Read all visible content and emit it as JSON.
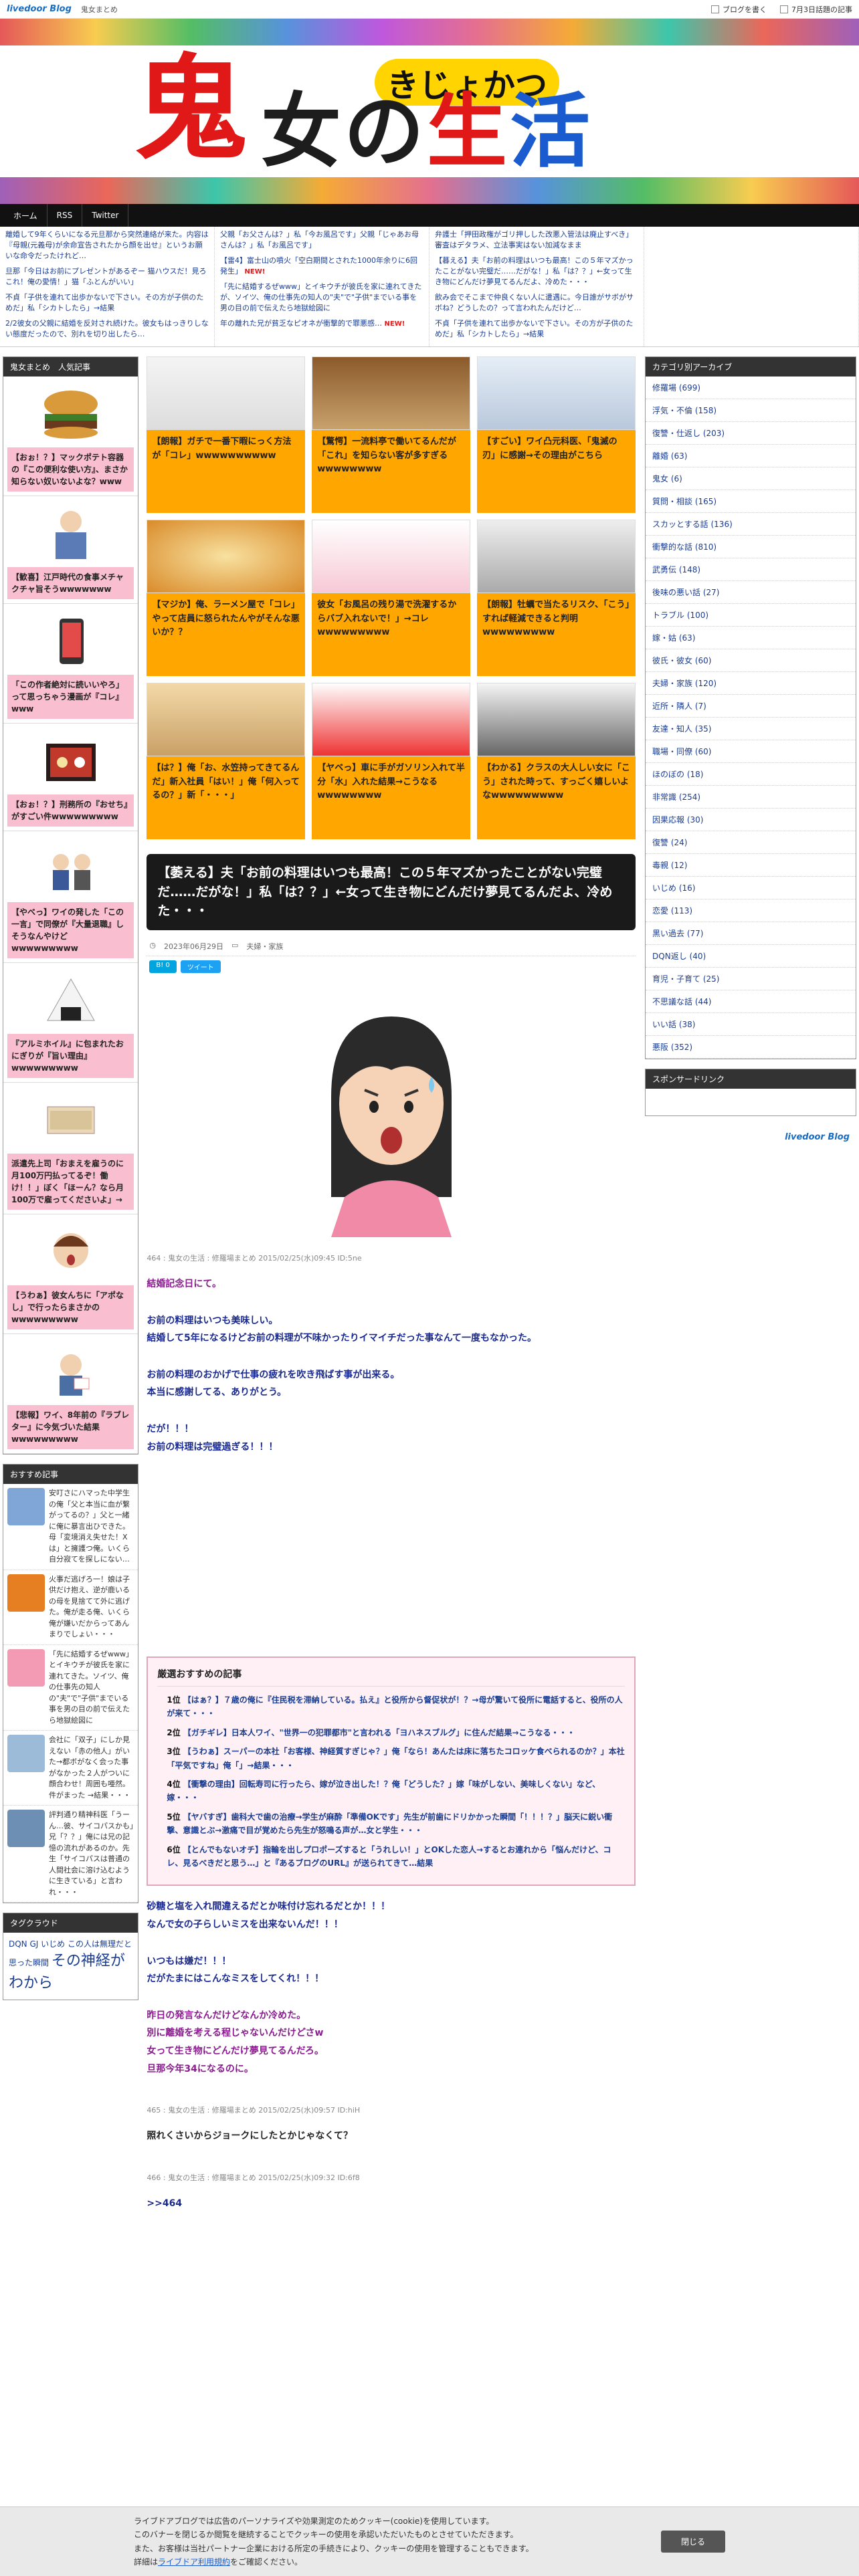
{
  "topbar": {
    "logo": "livedoor Blog",
    "blog_name": "鬼女まとめ",
    "write_link": "ブログを書く",
    "hot_link": "7月3日話題の記事"
  },
  "banner": {
    "kanji_oni": "鬼",
    "kanji_no": "の",
    "kanji_sei": "生",
    "kanji_katsu": "活",
    "kanji_onna": "女",
    "ruby": "きじょかつ"
  },
  "nav": [
    "ホーム",
    "RSS",
    "Twitter"
  ],
  "ticker": [
    [
      "離婚して9年くらいになる元旦那から突然連絡が来た。内容は『母親(元義母)が余命宣告されたから顔を出せ』というお願いな命令だったけれど…",
      "旦那「今日はお前にプレゼントがあるぞー 猫ハウスだ！見ろこれ！俺の愛情！」猫「ふとんがいい」",
      "不貞「子供を連れて出歩かないで下さい。その方が子供のためだ」私「シカトしたら」→結果",
      "2/2彼女の父親に結婚を反対され続けた。彼女もはっきりしない態度だったので、別れを切り出したら…"
    ],
    [
      "父親「お父さんは？」私「今お風呂です」父親「じゃあお母さんは？」私「お風呂です」",
      "【雷4】富士山の噴火「空白期間とされた1000年余りに6回発生」",
      "「先に結婚するぜwww」とイキウチが彼氏を家に連れてきたが、ソイツ、俺の仕事先の知人の\"夫\"で\"子供\"までいる事を男の目の前で伝えたら地獄絵図に",
      "年の離れた兄が貧乏なピオネが衝撃的で罪悪感…"
    ],
    [
      "弁護士「押田政権がゴリ押しした改悪入管法は廃止すべき」審査はデタラメ、立法事実はない加減なまま",
      "【暮える】夫「お前の料理はいつも最高！この５年マズかったことがない完璧だ……だがな！」私「は？？」←女って生き物にどんだけ夢見てるんだよ、冷めた・・・",
      "飲み会でそこまで仲良くない人に遭遇に。今日誰がサボがサボね？どうしたの？って言われたんだけど…",
      "不貞「子供を連れて出歩かないで下さい。その方が子供のためだ」私「シカトしたら」→結果"
    ],
    []
  ],
  "left": {
    "popular_title": "鬼女まとめ　人気記事",
    "popular": [
      "【おぉ！？】マックポテト容器の『この便利な使い方』、まさか知らない奴いないよな？www",
      "【歓喜】江戸時代の食事メチャクチャ旨そうwwwwwww",
      "「この作者絶対に読いいやろ」って思っちゃう漫画が『コレ』www",
      "【おぉ！？】刑務所の『おせち』がすごい件wwwwwwwww",
      "【やべっ】ワイの発した「この一言」で同僚が『大量退職』しそうなんやけどwwwwwwwww",
      "『アルミホイル』に包まれたおにぎりが『旨い理由』wwwwwwwww",
      "派遣先上司「おまえを雇うのに月100万円払ってるぞ！働け！！」ぼく「ほーん？なら月100万で雇ってくださいよ」→",
      "【うわぁ】彼女んちに「アポなし」で行ったらまさかのwwwwwwwww",
      "【悲報】ワイ、8年前の『ラブレター』に今気づいた結果wwwwwwwww"
    ],
    "recent_title": "おすすめ記事",
    "recent": [
      "安叮さにハマった中学生の俺「父と本当に血が繋がってるの？」父と一緒に俺に暴言出ひできた。母「変境消え失せた！Xは」と擁護つ俺。いくら自分寂てを探しにない…",
      "火事だ逃げろ一！娘は子供だけ抱え、逆が鹿いるの母を見捨てて外に逃げた。俺が走る俺、いくら俺が嫌いだからってあんまりでしょい・・・",
      "「先に結婚するぜwww」とイキウチが彼氏を家に連れてきた。ソイツ、俺の仕事先の知人の\"夫\"で\"子供\"までいる事を男の目の前で伝えたら地獄絵図に",
      "会社に「双子」にしか見えない「赤の他人」がいた→都ボがなく会った事がなかった２人がついに顔合わせ！周囲も唖然。件がまった →結果・・・",
      "評判通り精神科医「うーん…彼、サイコパスかも」兄「？？」俺には兄の記憶の流れがあるのか。先生「サイコパスは普通の人間社会に溶け込むように生きている」と言われ・・・"
    ],
    "tag_title": "タグクラウド",
    "tags": "DQN GJ いじめ この人は無理だと思った瞬間",
    "tags_big": "その神経がわから"
  },
  "grid": [
    "【朗報】ガチで一番下暇にっく方法が「コレ」wwwwwwwwww",
    "【驚愕】一流料亭で働いてるんだが「これ」を知らない客が多すぎるwwwwwwww",
    "【すごい】ワイ凸元科医、「鬼滅の刃」に感謝→その理由がこちら",
    "【マジか】俺、ラーメン屋で「コレ」やって店員に怒られたんやがそんな悪いか？？",
    "彼女「お風呂の残り湯で洗濯するからバブ入れないで！」→コレwwwwwwwww",
    "【朗報】牡蠣で当たるリスク、「こう」すれば軽減できると判明wwwwwwwww",
    "【は？】俺「お、水笠持ってきてるんだ」新入社員「はい！」俺「何入ってるの？」新「・・・」",
    "【ヤベっ】車に手がガソリン入れて半分「水」入れた結果→こうなるwwwwwwww",
    "【わかる】クラスの大人しい女に「こう」された時って、すっごく嬉しいよなwwwwwwwww"
  ],
  "article": {
    "title": "【萎える】夫「お前の料理はいつも最高！この５年マズかったことがない完璧だ……だがな！」私「は？？」←女って生き物にどんだけ夢見てるんだよ、冷めた・・・",
    "date": "2023年06月29日",
    "category": "夫婦・家族",
    "hatena": "B! 0",
    "tweet": "ツイート",
    "res1_meta": "464 : 鬼女の生活 : 修羅場まとめ 2015/02/25(水)09:45 ID:5ne",
    "res1_lines_purple": [
      "結婚記念日にて。"
    ],
    "res1_lines_navy": [
      "お前の料理はいつも美味しい。",
      "結婚して5年になるけどお前の料理が不味かったりイマイチだった事なんて一度もなかった。",
      "",
      "お前の料理のおかげで仕事の疲れを吹き飛ばす事が出来る。",
      "本当に感謝してる、ありがとう。",
      "",
      "だが！！！",
      "お前の料理は完璧過ぎる！！！"
    ],
    "res2_lines_navy": [
      "砂糖と塩を入れ間違えるだとか味付け忘れるだとか！！！",
      "なんで女の子らしいミスを出来ないんだ！！！",
      "",
      "いつもは嫌だ！！！",
      "だがたまにはこんなミスをしてくれ！！！"
    ],
    "res2_lines_purple": [
      "昨日の発言なんだけどなんか冷めた。",
      "別に離婚を考える程じゃないんだけどさw",
      "女って生き物にどんだけ夢見てるんだろ。",
      "旦那今年34になるのに。"
    ],
    "res3_meta": "465 : 鬼女の生活 : 修羅場まとめ 2015/02/25(水)09:57 ID:hiH",
    "res3_text": "照れくさいからジョークにしたとかじゃなくて？",
    "res4_meta": "466 : 鬼女の生活 : 修羅場まとめ 2015/02/25(水)09:32 ID:6f8",
    "res4_text": ">>464"
  },
  "ranking": {
    "title": "厳選おすすめの記事",
    "items": [
      {
        "rank": "1位",
        "text": "【はぁ？】７歳の俺に『住民税を滞納している。払え』と役所から督促状が！？→母が驚いて役所に電話すると、役所の人が来て・・・"
      },
      {
        "rank": "2位",
        "text": "【ガチギレ】日本人ワイ、\"世界一の犯罪都市\"と言われる「ヨハネスブルグ」に住んだ結果→こうなる・・・"
      },
      {
        "rank": "3位",
        "text": "【うわぁ】スーパーの本社「お客様、神経質すぎじゃ？」俺「なら！あんたは床に落ちたコロッケ食べられるのか？」本社「平気ですね」俺「」→結果・・・"
      },
      {
        "rank": "4位",
        "text": "【衝撃の理由】回転寿司に行ったら、嫁が泣き出した！？俺「どうした？」嫁「味がしない、美味しくない」など、嫁・・・"
      },
      {
        "rank": "5位",
        "text": "【ヤバすぎ】歯科大で歯の治療→学生が麻酔「準備OKです」先生が前歯にドリかかった瞬間「！！！？」脳天に鋭い衝撃、意識とぶ→激痛で目が覚めたら先生が怒鳴る声が…女と学生・・・"
      },
      {
        "rank": "6位",
        "text": "【とんでもないオチ】指輪を出しプロポーズすると「うれしい！」とOKした恋人→するとお連れから「悩んだけど、コレ、見るべきだと思う…」と『あるブログのURL』が送られてきて…結果"
      }
    ]
  },
  "right": {
    "cat_title": "カテゴリ別アーカイブ",
    "cats": [
      "修羅場 (699)",
      "浮気・不倫 (158)",
      "復讐・仕返し (203)",
      "離婚 (63)",
      "鬼女 (6)",
      "質問・相談 (165)",
      "スカッとする話 (136)",
      "衝撃的な話 (810)",
      "武勇伝 (148)",
      "後味の悪い話 (27)",
      "トラブル (100)",
      "嫁・姑 (63)",
      "彼氏・彼女 (60)",
      "夫婦・家族 (120)",
      "近所・隣人 (7)",
      "友達・知人 (35)",
      "職場・同僚 (60)",
      "ほのぼの (18)",
      "非常識 (254)",
      "因果応報 (30)",
      "復讐 (24)",
      "毒親 (12)",
      "いじめ (16)",
      "恋愛 (113)",
      "黒い過去 (77)",
      "DQN返し (40)",
      "育児・子育て (25)",
      "不思議な話 (44)",
      "いい話 (38)",
      "悪阪 (352)"
    ],
    "sponsor_title": "スポンサードリンク",
    "livedoor": "livedoor Blog"
  },
  "cookie": {
    "text_1": "ライブドアブログでは広告のパーソナライズや効果測定のためクッキー(cookie)を使用しています。",
    "text_2": "このバナーを閉じるか閲覧を継続することでクッキーの使用を承認いただいたものとさせていただきます。",
    "text_3": "また、お客様は当社パートナー企業における所定の手続きにより、クッキーの使用を管理することもできます。",
    "text_4_prefix": "詳細は",
    "text_4_link": "ライブドア利用規約",
    "text_4_suffix": "をご確認ください。",
    "close": "閉じる"
  }
}
